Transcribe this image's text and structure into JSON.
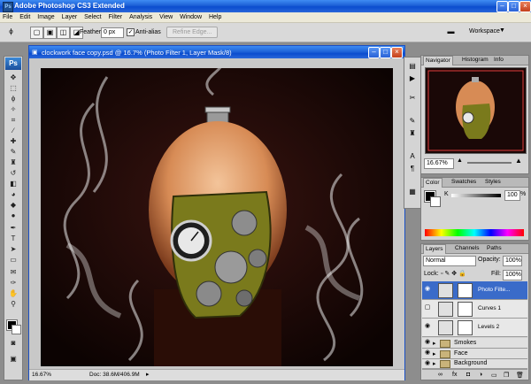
{
  "app": {
    "title": "Adobe Photoshop CS3 Extended"
  },
  "menu": [
    "File",
    "Edit",
    "Image",
    "Layer",
    "Select",
    "Filter",
    "Analysis",
    "View",
    "Window",
    "Help"
  ],
  "options": {
    "feather_label": "Feather:",
    "feather_value": "0 px",
    "antialias_label": "Anti-alias",
    "refine_label": "Refine Edge...",
    "workspace_label": "Workspace"
  },
  "document": {
    "title": "clockwork face copy.psd @ 16.7% (Photo Filter 1, Layer Mask/8)",
    "zoom": "16.67%",
    "doc_size": "Doc: 38.6M/406.9M"
  },
  "navigator": {
    "tabs": [
      "Navigator",
      "Histogram",
      "Info"
    ],
    "zoom": "16.67%"
  },
  "color_panel": {
    "tabs": [
      "Color",
      "Swatches",
      "Styles"
    ],
    "channel": "K",
    "value": "100",
    "unit": "%"
  },
  "layers_panel": {
    "tabs": [
      "Layers",
      "Channels",
      "Paths"
    ],
    "blend_mode": "Normal",
    "opacity_label": "Opacity:",
    "opacity": "100%",
    "lock_label": "Lock:",
    "fill_label": "Fill:",
    "fill": "100%",
    "layers": [
      {
        "name": "Photo Filte...",
        "selected": true
      },
      {
        "name": "Curves 1",
        "selected": false
      },
      {
        "name": "Levels 2",
        "selected": false
      }
    ],
    "groups": [
      "Smokes",
      "Face",
      "Background"
    ]
  },
  "colors": {
    "titlebar": "#1c5fd6",
    "selection": "#3a6bc9"
  }
}
